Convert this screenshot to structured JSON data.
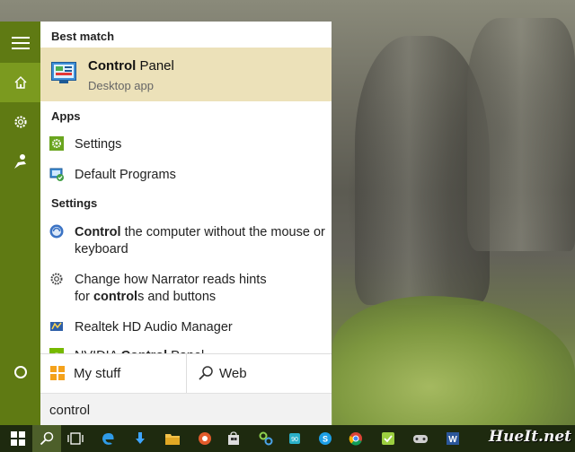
{
  "rail": {
    "items": [
      {
        "icon": "hamburger-menu-icon"
      },
      {
        "icon": "home-icon"
      },
      {
        "icon": "gear-icon"
      },
      {
        "icon": "feedback-icon"
      },
      {
        "icon": "cortana-circle-icon"
      }
    ]
  },
  "best_match": {
    "heading": "Best match",
    "name_bold": "Control",
    "name_rest": " Panel",
    "subtitle": "Desktop app"
  },
  "apps": {
    "heading": "Apps",
    "items": [
      {
        "label": "Settings",
        "icon": "settings-gear-icon"
      },
      {
        "label": "Default Programs",
        "icon": "default-programs-icon"
      }
    ]
  },
  "settings": {
    "heading": "Settings",
    "items": [
      {
        "bold": "Control",
        "rest": " the computer without the mouse or keyboard",
        "icon": "ease-of-access-icon"
      },
      {
        "line1": "Change how Narrator reads hints",
        "line2_pre": "for ",
        "line2_bold": "control",
        "line2_post": "s and buttons",
        "icon": "gear-icon"
      },
      {
        "label": "Realtek HD Audio Manager",
        "icon": "realtek-audio-icon"
      },
      {
        "pre": "NVIDIA ",
        "bold": "Control",
        "post": " Panel",
        "icon": "nvidia-icon"
      }
    ]
  },
  "tabs": {
    "my_stuff": "My stuff",
    "web": "Web"
  },
  "search": {
    "value": "control"
  },
  "taskbar": {
    "watermark": "HueIt.net",
    "icons": [
      "windows-start-icon",
      "search-icon",
      "task-view-icon",
      "edge-icon",
      "download-icon",
      "file-explorer-icon",
      "app-icon",
      "store-icon",
      "network-icon",
      "phone-icon",
      "skype-icon",
      "chrome-icon",
      "green-app-icon",
      "game-icon",
      "word-icon"
    ]
  },
  "colors": {
    "accent_rail": "#5f7a13",
    "accent_active": "#7b9a1f",
    "best_match_bg": "#ece1b9",
    "taskbar_bg": "#1e2a0f"
  }
}
